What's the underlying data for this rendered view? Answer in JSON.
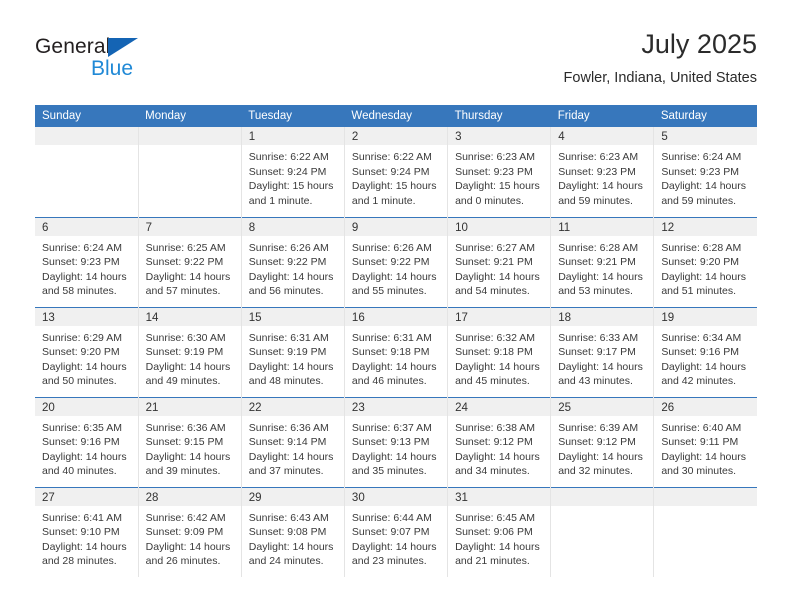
{
  "brand": {
    "name_top": "General",
    "name_bottom": "Blue",
    "triangle_color": "#1464b4",
    "blue_text_color": "#2089d6"
  },
  "header": {
    "title": "July 2025",
    "subtitle": "Fowler, Indiana, United States"
  },
  "theme": {
    "header_bg": "#3777bc",
    "row_divider": "#3777bc",
    "day_number_bg": "#f0f0f0",
    "cell_divider": "#e4e4e4",
    "text": "#3a3a3a"
  },
  "labels": {
    "sunrise_prefix": "Sunrise:",
    "sunset_prefix": "Sunset:",
    "daylight_prefix": "Daylight:"
  },
  "weekdays": [
    "Sunday",
    "Monday",
    "Tuesday",
    "Wednesday",
    "Thursday",
    "Friday",
    "Saturday"
  ],
  "weeks": [
    [
      {
        "day": "",
        "sunrise": "",
        "sunset": "",
        "daylight_line1": "",
        "daylight_line2": ""
      },
      {
        "day": "",
        "sunrise": "",
        "sunset": "",
        "daylight_line1": "",
        "daylight_line2": ""
      },
      {
        "day": "1",
        "sunrise": "Sunrise: 6:22 AM",
        "sunset": "Sunset: 9:24 PM",
        "daylight_line1": "Daylight: 15 hours",
        "daylight_line2": "and 1 minute."
      },
      {
        "day": "2",
        "sunrise": "Sunrise: 6:22 AM",
        "sunset": "Sunset: 9:24 PM",
        "daylight_line1": "Daylight: 15 hours",
        "daylight_line2": "and 1 minute."
      },
      {
        "day": "3",
        "sunrise": "Sunrise: 6:23 AM",
        "sunset": "Sunset: 9:23 PM",
        "daylight_line1": "Daylight: 15 hours",
        "daylight_line2": "and 0 minutes."
      },
      {
        "day": "4",
        "sunrise": "Sunrise: 6:23 AM",
        "sunset": "Sunset: 9:23 PM",
        "daylight_line1": "Daylight: 14 hours",
        "daylight_line2": "and 59 minutes."
      },
      {
        "day": "5",
        "sunrise": "Sunrise: 6:24 AM",
        "sunset": "Sunset: 9:23 PM",
        "daylight_line1": "Daylight: 14 hours",
        "daylight_line2": "and 59 minutes."
      }
    ],
    [
      {
        "day": "6",
        "sunrise": "Sunrise: 6:24 AM",
        "sunset": "Sunset: 9:23 PM",
        "daylight_line1": "Daylight: 14 hours",
        "daylight_line2": "and 58 minutes."
      },
      {
        "day": "7",
        "sunrise": "Sunrise: 6:25 AM",
        "sunset": "Sunset: 9:22 PM",
        "daylight_line1": "Daylight: 14 hours",
        "daylight_line2": "and 57 minutes."
      },
      {
        "day": "8",
        "sunrise": "Sunrise: 6:26 AM",
        "sunset": "Sunset: 9:22 PM",
        "daylight_line1": "Daylight: 14 hours",
        "daylight_line2": "and 56 minutes."
      },
      {
        "day": "9",
        "sunrise": "Sunrise: 6:26 AM",
        "sunset": "Sunset: 9:22 PM",
        "daylight_line1": "Daylight: 14 hours",
        "daylight_line2": "and 55 minutes."
      },
      {
        "day": "10",
        "sunrise": "Sunrise: 6:27 AM",
        "sunset": "Sunset: 9:21 PM",
        "daylight_line1": "Daylight: 14 hours",
        "daylight_line2": "and 54 minutes."
      },
      {
        "day": "11",
        "sunrise": "Sunrise: 6:28 AM",
        "sunset": "Sunset: 9:21 PM",
        "daylight_line1": "Daylight: 14 hours",
        "daylight_line2": "and 53 minutes."
      },
      {
        "day": "12",
        "sunrise": "Sunrise: 6:28 AM",
        "sunset": "Sunset: 9:20 PM",
        "daylight_line1": "Daylight: 14 hours",
        "daylight_line2": "and 51 minutes."
      }
    ],
    [
      {
        "day": "13",
        "sunrise": "Sunrise: 6:29 AM",
        "sunset": "Sunset: 9:20 PM",
        "daylight_line1": "Daylight: 14 hours",
        "daylight_line2": "and 50 minutes."
      },
      {
        "day": "14",
        "sunrise": "Sunrise: 6:30 AM",
        "sunset": "Sunset: 9:19 PM",
        "daylight_line1": "Daylight: 14 hours",
        "daylight_line2": "and 49 minutes."
      },
      {
        "day": "15",
        "sunrise": "Sunrise: 6:31 AM",
        "sunset": "Sunset: 9:19 PM",
        "daylight_line1": "Daylight: 14 hours",
        "daylight_line2": "and 48 minutes."
      },
      {
        "day": "16",
        "sunrise": "Sunrise: 6:31 AM",
        "sunset": "Sunset: 9:18 PM",
        "daylight_line1": "Daylight: 14 hours",
        "daylight_line2": "and 46 minutes."
      },
      {
        "day": "17",
        "sunrise": "Sunrise: 6:32 AM",
        "sunset": "Sunset: 9:18 PM",
        "daylight_line1": "Daylight: 14 hours",
        "daylight_line2": "and 45 minutes."
      },
      {
        "day": "18",
        "sunrise": "Sunrise: 6:33 AM",
        "sunset": "Sunset: 9:17 PM",
        "daylight_line1": "Daylight: 14 hours",
        "daylight_line2": "and 43 minutes."
      },
      {
        "day": "19",
        "sunrise": "Sunrise: 6:34 AM",
        "sunset": "Sunset: 9:16 PM",
        "daylight_line1": "Daylight: 14 hours",
        "daylight_line2": "and 42 minutes."
      }
    ],
    [
      {
        "day": "20",
        "sunrise": "Sunrise: 6:35 AM",
        "sunset": "Sunset: 9:16 PM",
        "daylight_line1": "Daylight: 14 hours",
        "daylight_line2": "and 40 minutes."
      },
      {
        "day": "21",
        "sunrise": "Sunrise: 6:36 AM",
        "sunset": "Sunset: 9:15 PM",
        "daylight_line1": "Daylight: 14 hours",
        "daylight_line2": "and 39 minutes."
      },
      {
        "day": "22",
        "sunrise": "Sunrise: 6:36 AM",
        "sunset": "Sunset: 9:14 PM",
        "daylight_line1": "Daylight: 14 hours",
        "daylight_line2": "and 37 minutes."
      },
      {
        "day": "23",
        "sunrise": "Sunrise: 6:37 AM",
        "sunset": "Sunset: 9:13 PM",
        "daylight_line1": "Daylight: 14 hours",
        "daylight_line2": "and 35 minutes."
      },
      {
        "day": "24",
        "sunrise": "Sunrise: 6:38 AM",
        "sunset": "Sunset: 9:12 PM",
        "daylight_line1": "Daylight: 14 hours",
        "daylight_line2": "and 34 minutes."
      },
      {
        "day": "25",
        "sunrise": "Sunrise: 6:39 AM",
        "sunset": "Sunset: 9:12 PM",
        "daylight_line1": "Daylight: 14 hours",
        "daylight_line2": "and 32 minutes."
      },
      {
        "day": "26",
        "sunrise": "Sunrise: 6:40 AM",
        "sunset": "Sunset: 9:11 PM",
        "daylight_line1": "Daylight: 14 hours",
        "daylight_line2": "and 30 minutes."
      }
    ],
    [
      {
        "day": "27",
        "sunrise": "Sunrise: 6:41 AM",
        "sunset": "Sunset: 9:10 PM",
        "daylight_line1": "Daylight: 14 hours",
        "daylight_line2": "and 28 minutes."
      },
      {
        "day": "28",
        "sunrise": "Sunrise: 6:42 AM",
        "sunset": "Sunset: 9:09 PM",
        "daylight_line1": "Daylight: 14 hours",
        "daylight_line2": "and 26 minutes."
      },
      {
        "day": "29",
        "sunrise": "Sunrise: 6:43 AM",
        "sunset": "Sunset: 9:08 PM",
        "daylight_line1": "Daylight: 14 hours",
        "daylight_line2": "and 24 minutes."
      },
      {
        "day": "30",
        "sunrise": "Sunrise: 6:44 AM",
        "sunset": "Sunset: 9:07 PM",
        "daylight_line1": "Daylight: 14 hours",
        "daylight_line2": "and 23 minutes."
      },
      {
        "day": "31",
        "sunrise": "Sunrise: 6:45 AM",
        "sunset": "Sunset: 9:06 PM",
        "daylight_line1": "Daylight: 14 hours",
        "daylight_line2": "and 21 minutes."
      },
      {
        "day": "",
        "sunrise": "",
        "sunset": "",
        "daylight_line1": "",
        "daylight_line2": ""
      },
      {
        "day": "",
        "sunrise": "",
        "sunset": "",
        "daylight_line1": "",
        "daylight_line2": ""
      }
    ]
  ]
}
